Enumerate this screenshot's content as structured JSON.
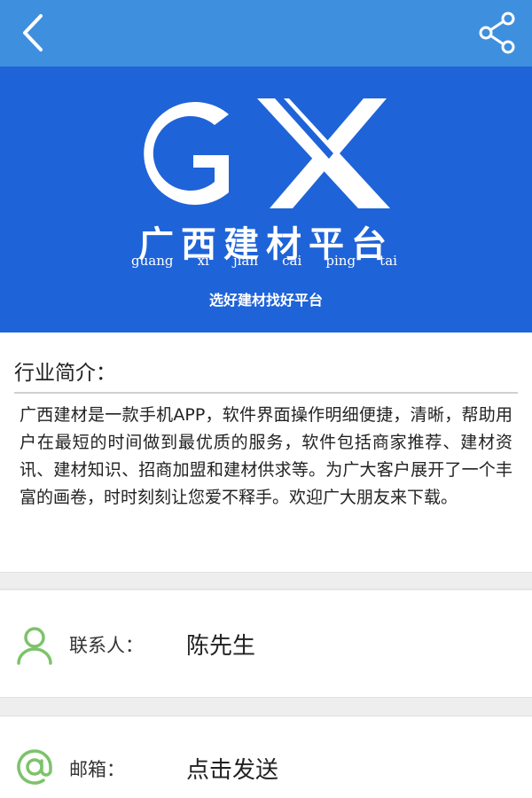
{
  "header": {
    "back_icon": "chevron-left-icon",
    "share_icon": "share-icon",
    "bar_color": "#3f8fdf"
  },
  "banner": {
    "logo_text": "GX",
    "brand_name": "广西建材平台",
    "pinyin": [
      "guang",
      "xi",
      "jian",
      "cai",
      "ping",
      "tai"
    ],
    "slogan": "选好建材找好平台",
    "background_color": "#1f63d8"
  },
  "intro": {
    "title": "行业简介：",
    "body": "广西建材是一款手机APP，软件界面操作明细便捷，清晰，帮助用户在最短的时间做到最优质的服务，软件包括商家推荐、建材资讯、建材知识、招商加盟和建材供求等。为广大客户展开了一个丰富的画卷，时时刻刻让您爱不释手。欢迎广大朋友来下载。"
  },
  "contact": {
    "person_label": "联系人：",
    "person_value": "陈先生",
    "person_icon": "user-icon",
    "email_label": "邮箱：",
    "email_value": "点击发送",
    "email_icon": "at-sign-icon",
    "icon_color": "#7cc36a"
  }
}
